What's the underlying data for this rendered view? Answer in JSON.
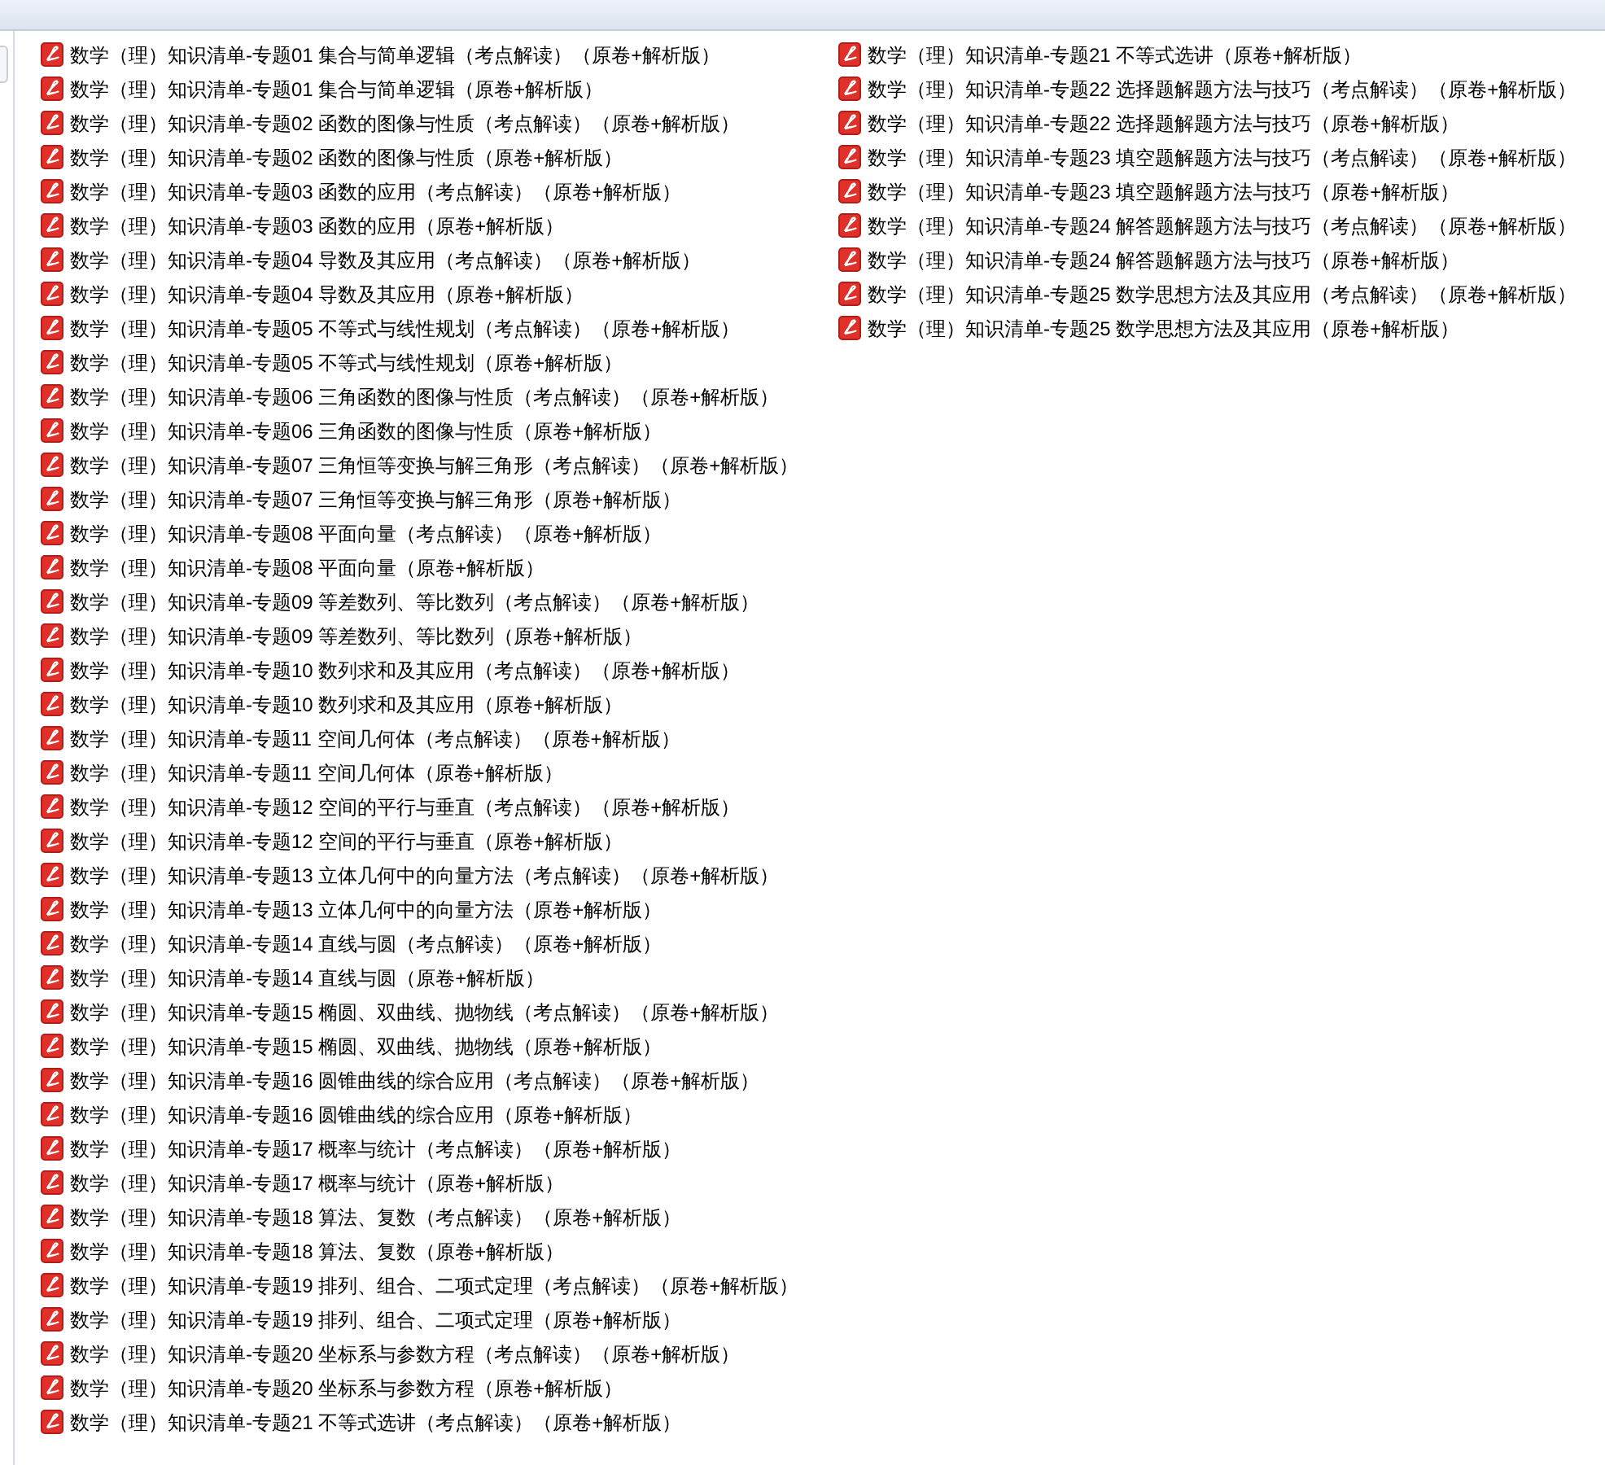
{
  "files": [
    {
      "name": "数学（理）知识清单-专题01 集合与简单逻辑（考点解读）（原卷+解析版）"
    },
    {
      "name": "数学（理）知识清单-专题01 集合与简单逻辑（原卷+解析版）"
    },
    {
      "name": "数学（理）知识清单-专题02 函数的图像与性质（考点解读）（原卷+解析版）"
    },
    {
      "name": "数学（理）知识清单-专题02 函数的图像与性质（原卷+解析版）"
    },
    {
      "name": "数学（理）知识清单-专题03 函数的应用（考点解读）（原卷+解析版）"
    },
    {
      "name": "数学（理）知识清单-专题03 函数的应用（原卷+解析版）"
    },
    {
      "name": "数学（理）知识清单-专题04 导数及其应用（考点解读）（原卷+解析版）"
    },
    {
      "name": "数学（理）知识清单-专题04 导数及其应用（原卷+解析版）"
    },
    {
      "name": "数学（理）知识清单-专题05 不等式与线性规划（考点解读）（原卷+解析版）"
    },
    {
      "name": "数学（理）知识清单-专题05 不等式与线性规划（原卷+解析版）"
    },
    {
      "name": "数学（理）知识清单-专题06 三角函数的图像与性质（考点解读）（原卷+解析版）"
    },
    {
      "name": "数学（理）知识清单-专题06 三角函数的图像与性质（原卷+解析版）"
    },
    {
      "name": "数学（理）知识清单-专题07 三角恒等变换与解三角形（考点解读）（原卷+解析版）"
    },
    {
      "name": "数学（理）知识清单-专题07 三角恒等变换与解三角形（原卷+解析版）"
    },
    {
      "name": "数学（理）知识清单-专题08 平面向量（考点解读）（原卷+解析版）"
    },
    {
      "name": "数学（理）知识清单-专题08 平面向量（原卷+解析版）"
    },
    {
      "name": "数学（理）知识清单-专题09 等差数列、等比数列（考点解读）（原卷+解析版）"
    },
    {
      "name": "数学（理）知识清单-专题09 等差数列、等比数列（原卷+解析版）"
    },
    {
      "name": "数学（理）知识清单-专题10 数列求和及其应用（考点解读）（原卷+解析版）"
    },
    {
      "name": "数学（理）知识清单-专题10 数列求和及其应用（原卷+解析版）"
    },
    {
      "name": "数学（理）知识清单-专题11 空间几何体（考点解读）（原卷+解析版）"
    },
    {
      "name": "数学（理）知识清单-专题11 空间几何体（原卷+解析版）"
    },
    {
      "name": "数学（理）知识清单-专题12 空间的平行与垂直（考点解读）（原卷+解析版）"
    },
    {
      "name": "数学（理）知识清单-专题12 空间的平行与垂直（原卷+解析版）"
    },
    {
      "name": "数学（理）知识清单-专题13 立体几何中的向量方法（考点解读）（原卷+解析版）"
    },
    {
      "name": "数学（理）知识清单-专题13 立体几何中的向量方法（原卷+解析版）"
    },
    {
      "name": "数学（理）知识清单-专题14 直线与圆（考点解读）（原卷+解析版）"
    },
    {
      "name": "数学（理）知识清单-专题14 直线与圆（原卷+解析版）"
    },
    {
      "name": "数学（理）知识清单-专题15 椭圆、双曲线、抛物线（考点解读）（原卷+解析版）"
    },
    {
      "name": "数学（理）知识清单-专题15 椭圆、双曲线、抛物线（原卷+解析版）"
    },
    {
      "name": "数学（理）知识清单-专题16 圆锥曲线的综合应用（考点解读）（原卷+解析版）"
    },
    {
      "name": "数学（理）知识清单-专题16 圆锥曲线的综合应用（原卷+解析版）"
    },
    {
      "name": "数学（理）知识清单-专题17 概率与统计（考点解读）（原卷+解析版）"
    },
    {
      "name": "数学（理）知识清单-专题17 概率与统计（原卷+解析版）"
    },
    {
      "name": "数学（理）知识清单-专题18 算法、复数（考点解读）（原卷+解析版）"
    },
    {
      "name": "数学（理）知识清单-专题18 算法、复数（原卷+解析版）"
    },
    {
      "name": "数学（理）知识清单-专题19 排列、组合、二项式定理（考点解读）（原卷+解析版）"
    },
    {
      "name": "数学（理）知识清单-专题19 排列、组合、二项式定理（原卷+解析版）"
    },
    {
      "name": "数学（理）知识清单-专题20 坐标系与参数方程（考点解读）（原卷+解析版）"
    },
    {
      "name": "数学（理）知识清单-专题20 坐标系与参数方程（原卷+解析版）"
    },
    {
      "name": "数学（理）知识清单-专题21 不等式选讲（考点解读）（原卷+解析版）"
    },
    {
      "name": "数学（理）知识清单-专题21 不等式选讲（原卷+解析版）"
    },
    {
      "name": "数学（理）知识清单-专题22 选择题解题方法与技巧（考点解读）（原卷+解析版）"
    },
    {
      "name": "数学（理）知识清单-专题22 选择题解题方法与技巧（原卷+解析版）"
    },
    {
      "name": "数学（理）知识清单-专题23 填空题解题方法与技巧（考点解读）（原卷+解析版）"
    },
    {
      "name": "数学（理）知识清单-专题23 填空题解题方法与技巧（原卷+解析版）"
    },
    {
      "name": "数学（理）知识清单-专题24 解答题解题方法与技巧（考点解读）（原卷+解析版）"
    },
    {
      "name": "数学（理）知识清单-专题24 解答题解题方法与技巧（原卷+解析版）"
    },
    {
      "name": "数学（理）知识清单-专题25 数学思想方法及其应用（考点解读）（原卷+解析版）"
    },
    {
      "name": "数学（理）知识清单-专题25 数学思想方法及其应用（原卷+解析版）"
    }
  ]
}
